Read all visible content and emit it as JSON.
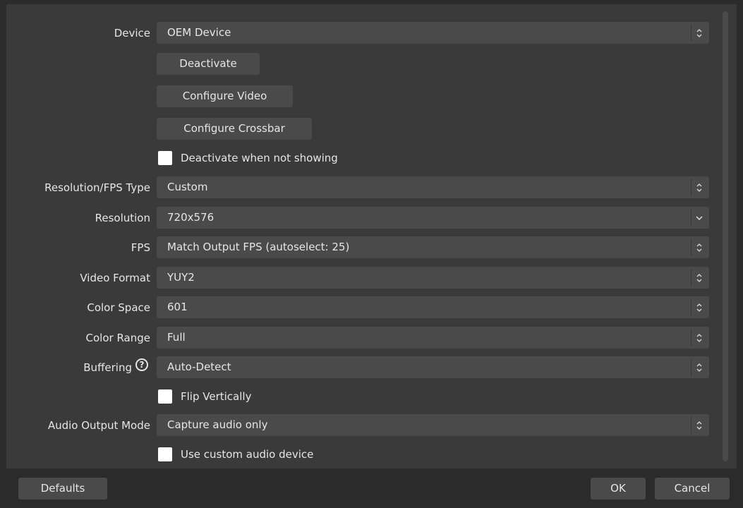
{
  "form": {
    "device": {
      "label": "Device",
      "value": "OEM Device"
    },
    "deactivate_button": "Deactivate",
    "configure_video_button": "Configure Video",
    "configure_crossbar_button": "Configure Crossbar",
    "deactivate_when_not_showing": {
      "label": "Deactivate when not showing",
      "checked": false
    },
    "resolution_fps_type": {
      "label": "Resolution/FPS Type",
      "value": "Custom"
    },
    "resolution": {
      "label": "Resolution",
      "value": "720x576"
    },
    "fps": {
      "label": "FPS",
      "value": "Match Output FPS (autoselect: 25)"
    },
    "video_format": {
      "label": "Video Format",
      "value": "YUY2"
    },
    "color_space": {
      "label": "Color Space",
      "value": "601"
    },
    "color_range": {
      "label": "Color Range",
      "value": "Full"
    },
    "buffering": {
      "label": "Buffering",
      "value": "Auto-Detect",
      "help_glyph": "?"
    },
    "flip_vertically": {
      "label": "Flip Vertically",
      "checked": false
    },
    "audio_output_mode": {
      "label": "Audio Output Mode",
      "value": "Capture audio only"
    },
    "use_custom_audio_device": {
      "label": "Use custom audio device",
      "checked": false
    }
  },
  "footer": {
    "defaults_button": "Defaults",
    "ok_button": "OK",
    "cancel_button": "Cancel"
  },
  "icons": {
    "spin_arrows": "updown-chevron-icon",
    "dropdown": "chevron-down-icon",
    "help": "help-circle-icon"
  }
}
